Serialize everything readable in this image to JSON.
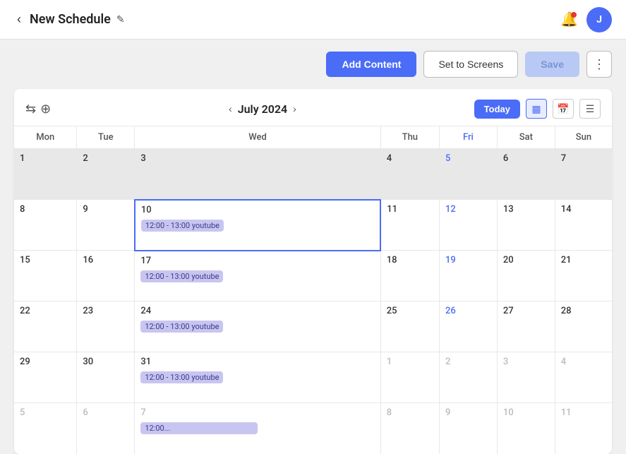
{
  "header": {
    "back_label": "‹",
    "title": "New Schedule",
    "edit_icon": "✎",
    "notif_icon": "🔔",
    "avatar_initials": "J"
  },
  "toolbar": {
    "add_content_label": "Add Content",
    "set_to_screens_label": "Set to Screens",
    "save_label": "Save",
    "more_icon": "⋮"
  },
  "calendar": {
    "controls": {
      "share_icon": "⇆",
      "add_icon": "⊕",
      "prev_icon": "‹",
      "next_icon": "›",
      "month_title": "July 2024",
      "today_label": "Today",
      "view_month_icon": "▦",
      "view_list_icon": "☰",
      "view_cal_icon": "📅"
    },
    "weekdays": [
      "Mon",
      "Tue",
      "Wed",
      "Thu",
      "Fri",
      "Sat",
      "Sun"
    ],
    "rows": [
      {
        "cells": [
          {
            "num": "1",
            "inactive": true,
            "selected": false,
            "event": null,
            "fri": false
          },
          {
            "num": "2",
            "inactive": true,
            "selected": false,
            "event": null,
            "fri": false
          },
          {
            "num": "3",
            "inactive": true,
            "selected": false,
            "event": null,
            "fri": false
          },
          {
            "num": "4",
            "inactive": true,
            "selected": false,
            "event": null,
            "fri": false
          },
          {
            "num": "5",
            "inactive": true,
            "selected": false,
            "event": null,
            "fri": true
          },
          {
            "num": "6",
            "inactive": true,
            "selected": false,
            "event": null,
            "fri": false
          },
          {
            "num": "7",
            "inactive": true,
            "selected": false,
            "event": null,
            "fri": false
          }
        ]
      },
      {
        "cells": [
          {
            "num": "8",
            "inactive": false,
            "selected": false,
            "event": null,
            "fri": false
          },
          {
            "num": "9",
            "inactive": false,
            "selected": false,
            "event": null,
            "fri": false
          },
          {
            "num": "10",
            "inactive": false,
            "selected": true,
            "event": "12:00 - 13:00 youtube",
            "fri": false
          },
          {
            "num": "11",
            "inactive": false,
            "selected": false,
            "event": null,
            "fri": false
          },
          {
            "num": "12",
            "inactive": false,
            "selected": false,
            "event": null,
            "fri": true
          },
          {
            "num": "13",
            "inactive": false,
            "selected": false,
            "event": null,
            "fri": false
          },
          {
            "num": "14",
            "inactive": false,
            "selected": false,
            "event": null,
            "fri": false
          }
        ]
      },
      {
        "cells": [
          {
            "num": "15",
            "inactive": false,
            "selected": false,
            "event": null,
            "fri": false
          },
          {
            "num": "16",
            "inactive": false,
            "selected": false,
            "event": null,
            "fri": false
          },
          {
            "num": "17",
            "inactive": false,
            "selected": false,
            "event": "12:00 - 13:00 youtube",
            "fri": false
          },
          {
            "num": "18",
            "inactive": false,
            "selected": false,
            "event": null,
            "fri": false
          },
          {
            "num": "19",
            "inactive": false,
            "selected": false,
            "event": null,
            "fri": true
          },
          {
            "num": "20",
            "inactive": false,
            "selected": false,
            "event": null,
            "fri": false
          },
          {
            "num": "21",
            "inactive": false,
            "selected": false,
            "event": null,
            "fri": false
          }
        ]
      },
      {
        "cells": [
          {
            "num": "22",
            "inactive": false,
            "selected": false,
            "event": null,
            "fri": false
          },
          {
            "num": "23",
            "inactive": false,
            "selected": false,
            "event": null,
            "fri": false
          },
          {
            "num": "24",
            "inactive": false,
            "selected": false,
            "event": "12:00 - 13:00 youtube",
            "fri": false
          },
          {
            "num": "25",
            "inactive": false,
            "selected": false,
            "event": null,
            "fri": false
          },
          {
            "num": "26",
            "inactive": false,
            "selected": false,
            "event": null,
            "fri": true
          },
          {
            "num": "27",
            "inactive": false,
            "selected": false,
            "event": null,
            "fri": false
          },
          {
            "num": "28",
            "inactive": false,
            "selected": false,
            "event": null,
            "fri": false
          }
        ]
      },
      {
        "cells": [
          {
            "num": "29",
            "inactive": false,
            "selected": false,
            "event": null,
            "fri": false
          },
          {
            "num": "30",
            "inactive": false,
            "selected": false,
            "event": null,
            "fri": false
          },
          {
            "num": "31",
            "inactive": false,
            "selected": false,
            "event": "12:00 - 13:00 youtube",
            "fri": false
          },
          {
            "num": "1",
            "inactive": false,
            "selected": false,
            "event": null,
            "fri": false,
            "other": true
          },
          {
            "num": "2",
            "inactive": false,
            "selected": false,
            "event": null,
            "fri": true,
            "other": true
          },
          {
            "num": "3",
            "inactive": false,
            "selected": false,
            "event": null,
            "fri": false,
            "other": true
          },
          {
            "num": "4",
            "inactive": false,
            "selected": false,
            "event": null,
            "fri": false,
            "other": true
          }
        ]
      },
      {
        "cells": [
          {
            "num": "5",
            "inactive": false,
            "selected": false,
            "event": null,
            "fri": false,
            "other": true
          },
          {
            "num": "6",
            "inactive": false,
            "selected": false,
            "event": null,
            "fri": false,
            "other": true
          },
          {
            "num": "7",
            "inactive": false,
            "selected": false,
            "event": "...",
            "fri": false,
            "other": true,
            "partial": true
          },
          {
            "num": "8",
            "inactive": false,
            "selected": false,
            "event": null,
            "fri": false,
            "other": true
          },
          {
            "num": "9",
            "inactive": false,
            "selected": false,
            "event": null,
            "fri": true,
            "other": true
          },
          {
            "num": "10",
            "inactive": false,
            "selected": false,
            "event": null,
            "fri": false,
            "other": true
          },
          {
            "num": "11",
            "inactive": false,
            "selected": false,
            "event": null,
            "fri": false,
            "other": true
          }
        ]
      }
    ]
  }
}
